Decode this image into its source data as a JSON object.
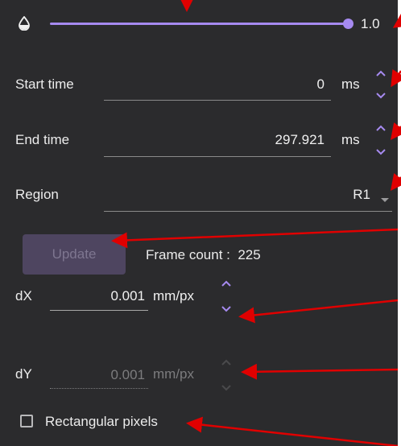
{
  "colors": {
    "panel_bg": "#2b2b2d",
    "accent": "#a68af0",
    "annotation": "#e00000",
    "disabled_text": "#7c7c7e"
  },
  "opacity": {
    "icon": "opacity-drop-icon",
    "value": "1.0",
    "level": 1.0
  },
  "start_time": {
    "label": "Start time",
    "value": "0",
    "unit": "ms"
  },
  "end_time": {
    "label": "End time",
    "value": "297.921",
    "unit": "ms"
  },
  "region": {
    "label": "Region",
    "value": "R1"
  },
  "update": {
    "button_label": "Update",
    "frame_count_text": "Frame count :  225"
  },
  "dx": {
    "label": "dX",
    "value": "0.001",
    "unit": "mm/px"
  },
  "dy": {
    "label": "dY",
    "value": "0.001",
    "unit": "mm/px"
  },
  "rect_pixels": {
    "label": "Rectangular pixels",
    "checked": false
  }
}
